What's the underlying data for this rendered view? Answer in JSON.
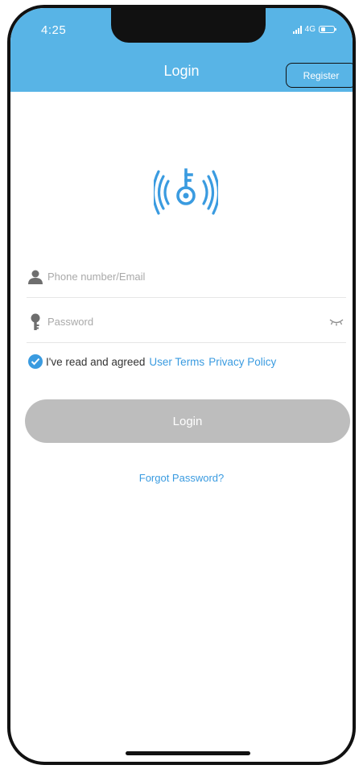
{
  "status_bar": {
    "time": "4:25",
    "network": "4G"
  },
  "header": {
    "title": "Login",
    "register_label": "Register"
  },
  "form": {
    "account": {
      "placeholder": "Phone number/Email",
      "value": "",
      "icon": "user-icon"
    },
    "password": {
      "placeholder": "Password",
      "value": "",
      "icon": "key-icon",
      "toggle_icon": "eye-closed-icon"
    }
  },
  "agreement": {
    "checked": true,
    "text": "I've read and agreed",
    "user_terms": "User Terms",
    "privacy_policy": "Privacy Policy"
  },
  "login_button": "Login",
  "forgot_password": "Forgot Password?",
  "colors": {
    "accent": "#58b4e6",
    "link": "#3a9be0",
    "button_disabled": "#bdbdbd"
  }
}
